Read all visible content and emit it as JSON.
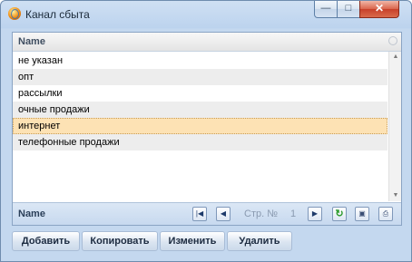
{
  "window": {
    "title": "Канал сбыта",
    "controls": {
      "minimize": "—",
      "maximize": "□",
      "close": "✕"
    }
  },
  "grid": {
    "column_header": "Name",
    "rows": [
      "не указан",
      "опт",
      "рассылки",
      "очные продажи",
      "интернет",
      "телефонные продажи"
    ],
    "selected_index": 4
  },
  "pager": {
    "footer_label": "Name",
    "page_label": "Стр. №",
    "page_number": "1",
    "icons": [
      "first-page-icon",
      "prev-page-icon",
      "next-page-icon",
      "refresh-icon",
      "save-icon",
      "print-icon"
    ]
  },
  "actions": {
    "add": "Добавить",
    "copy": "Копировать",
    "edit": "Изменить",
    "delete": "Удалить"
  },
  "colors": {
    "selected_row": "#fde2b4",
    "window_frame": "#c4d8ef",
    "close_button": "#c7402a"
  }
}
